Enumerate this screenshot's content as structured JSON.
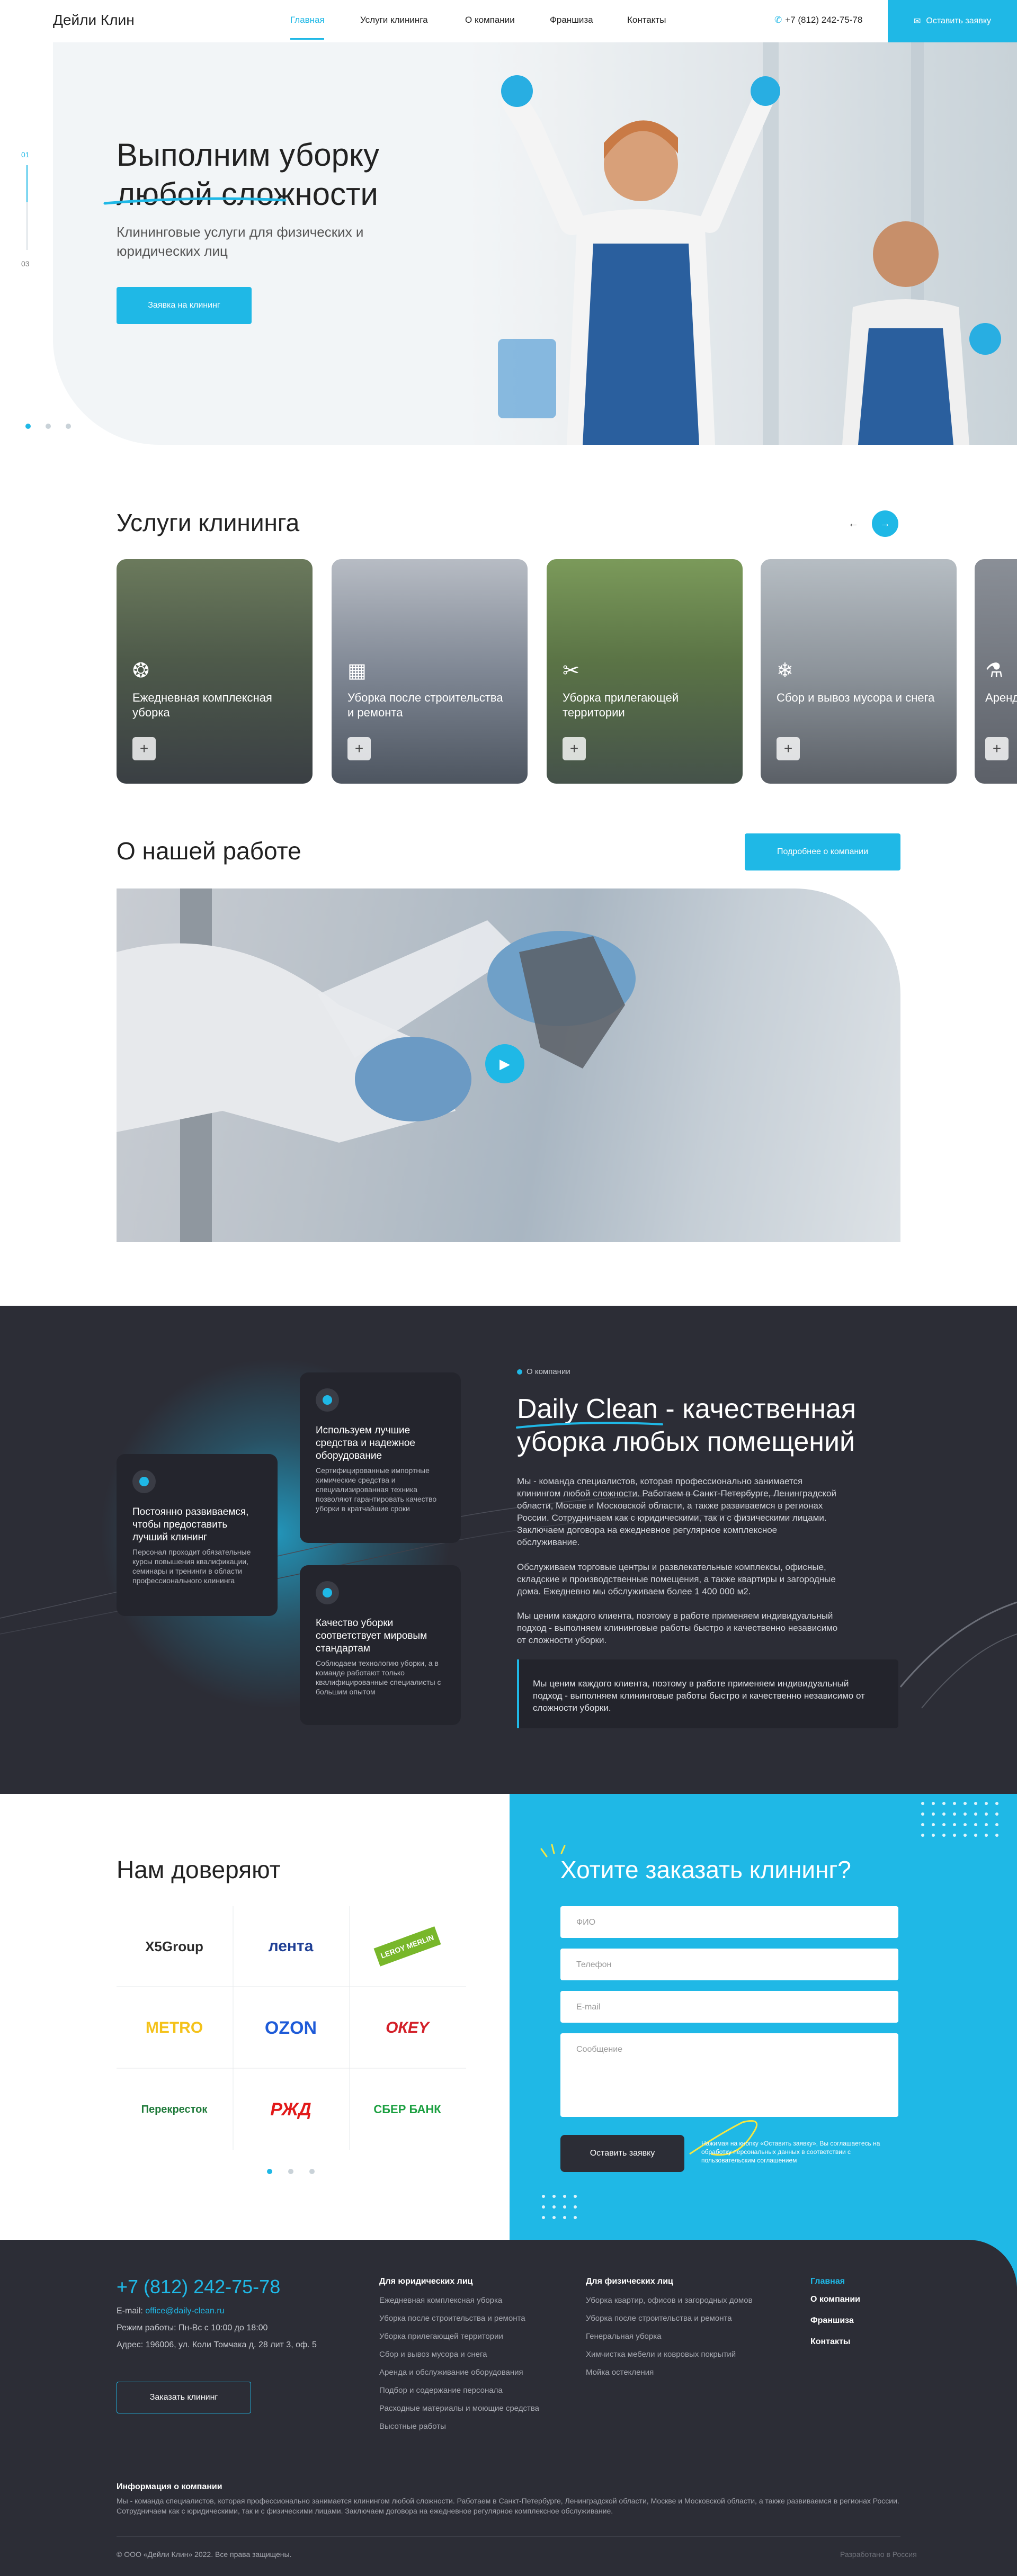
{
  "brand": {
    "name": "Дейли Клин",
    "accent": "#1fb8e6",
    "dark": "#2c2d36"
  },
  "header": {
    "nav": [
      "Главная",
      "Услуги клининга",
      "О компании",
      "Франшиза",
      "Контакты"
    ],
    "phone": "+7 (812) 242-75-78",
    "cta": "Оставить заявку"
  },
  "hero": {
    "title_line1": "Выполним уборку",
    "title_line2": "любой сложности",
    "subtitle": "Клининговые услуги для физических и юридических лиц",
    "button": "Заявка на клининг",
    "slide_current": "01",
    "slide_total": "03"
  },
  "services": {
    "title": "Услуги клининга",
    "cards": [
      {
        "label": "Ежедневная комплексная уборка",
        "icon": "bubbles-icon"
      },
      {
        "label": "Уборка после строительства и ремонта",
        "icon": "building-icon"
      },
      {
        "label": "Уборка прилегающей территории",
        "icon": "tools-icon"
      },
      {
        "label": "Сбор и вывоз мусора и снега",
        "icon": "snowflake-icon"
      },
      {
        "label": "Аренда оборудования",
        "icon": "bottle-icon"
      }
    ]
  },
  "about": {
    "title": "О нашей работе",
    "button": "Подробнее о компании"
  },
  "features": [
    {
      "title": "Постоянно развиваемся, чтобы предоставить лучший клининг",
      "desc": "Персонал проходит обязательные курсы повышения квалификации, семинары и тренинги в области профессионального клининга"
    },
    {
      "title": "Используем лучшие средства и надежное оборудование",
      "desc": "Сертифицированные импортные химические средства и специализированная техника позволяют гарантировать качество уборки в кратчайшие сроки"
    },
    {
      "title": "Качество уборки соответствует мировым стандартам",
      "desc": "Соблюдаем технологию уборки, а в команде работают только квалифицированные специалисты с большим опытом"
    }
  ],
  "company": {
    "kicker": "О компании",
    "heading_brand": "Daily Clean",
    "heading_rest": " - качественная уборка любых помещений",
    "p1": "Мы - команда специалистов, которая профессионально занимается клинингом любой сложности. Работаем в Санкт-Петербурге, Ленинградской области, Москве и Московской области, а также развиваемся в регионах России. Сотрудничаем как с юридическими, так и с физическими лицами. Заключаем договора на ежедневное регулярное комплексное обслуживание.",
    "p2": "Обслуживаем торговые центры и развлекательные комплексы, офисные, складские и производственные помещения, а также квартиры и загородные дома. Ежедневно мы обслуживаем более 1 400 000 м2.",
    "p3": "Мы ценим каждого клиента, поэтому в работе применяем индивидуальный подход - выполняем клининговые работы быстро и качественно независимо от сложности уборки.",
    "quote": "Мы ценим каждого клиента, поэтому в работе применяем индивидуальный подход - выполняем клининговые работы быстро и качественно независимо от сложности уборки."
  },
  "trust": {
    "title": "Нам доверяют",
    "logos": [
      {
        "text": "X5Group",
        "color": "#2b2b2b"
      },
      {
        "text": "лента",
        "color": "#1f3f95"
      },
      {
        "text": "LEROY MERLIN",
        "color": "#222222"
      },
      {
        "text": "METRO",
        "color": "#f4c21a"
      },
      {
        "text": "OZON",
        "color": "#1e5bd8"
      },
      {
        "text": "ОКЕY",
        "color": "#d32029"
      },
      {
        "text": "Перекресток",
        "color": "#1f7a3a"
      },
      {
        "text": "РЖД",
        "color": "#e21a1a"
      },
      {
        "text": "СБЕР БАНК",
        "color": "#1a9f3f"
      }
    ]
  },
  "order": {
    "title": "Хотите заказать клининг?",
    "fio": "ФИО",
    "phone": "Телефон",
    "email": "E-mail",
    "message": "Сообщение",
    "button": "Оставить заявку",
    "consent": "Нажимая на кнопку «Оставить заявку», Вы соглашаетесь на обработку персональных данных в соответствии с пользовательским соглашением"
  },
  "footer": {
    "phone": "+7 (812) 242-75-78",
    "email_label": "E-mail: ",
    "email": "office@daily-clean.ru",
    "hours": "Режим работы: Пн-Вс с 10:00 до 18:00",
    "address": "Адрес: 196006, ул. Коли Томчака д. 28 лит 3, оф. 5",
    "button": "Заказать клининг",
    "col1_title": "Для юридических лиц",
    "col1": [
      "Ежедневная комплексная уборка",
      "Уборка после строительства и ремонта",
      "Уборка прилегающей территории",
      "Сбор и вывоз мусора и снега",
      "Аренда и обслуживание оборудования",
      "Подбор и содержание персонала",
      "Расходные материалы и моющие средства",
      "Высотные работы"
    ],
    "col2_title": "Для физических лиц",
    "col2": [
      "Уборка квартир, офисов и загородных домов",
      "Уборка после строительства и ремонта",
      "Генеральная уборка",
      "Химчистка мебели и ковровых покрытий",
      "Мойка остекления"
    ],
    "nav": [
      "Главная",
      "О компании",
      "Франшиза",
      "Контакты"
    ],
    "info_title": "Информация о компании",
    "info_text": "Мы - команда специалистов, которая профессионально занимается клинингом любой сложности. Работаем в Санкт-Петербурге, Ленинградской области, Москве и Московской области, а также развиваемся в регионах России. Сотрудничаем как с юридическими, так и с физическими лицами. Заключаем договора на ежедневное регулярное комплексное обслуживание.",
    "copyright": "© ООО «Дейли Клин» 2022. Все права защищены.",
    "made": "Разработано в Россия"
  }
}
